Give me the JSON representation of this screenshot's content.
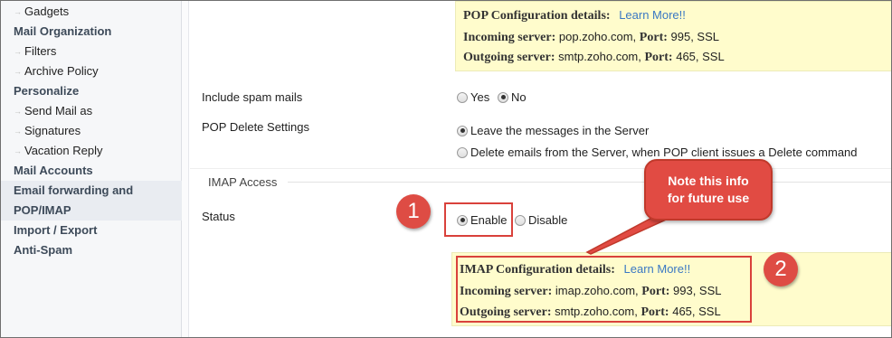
{
  "sidebar": {
    "items": [
      {
        "label": "Gadgets",
        "kind": "sub"
      },
      {
        "label": "Mail Organization",
        "kind": "heading"
      },
      {
        "label": "Filters",
        "kind": "sub"
      },
      {
        "label": "Archive Policy",
        "kind": "sub"
      },
      {
        "label": "Personalize",
        "kind": "heading"
      },
      {
        "label": "Send Mail as",
        "kind": "sub"
      },
      {
        "label": "Signatures",
        "kind": "sub"
      },
      {
        "label": "Vacation Reply",
        "kind": "sub"
      },
      {
        "label": "Mail Accounts",
        "kind": "heading"
      },
      {
        "label": "Email forwarding and",
        "kind": "heading",
        "active": true
      },
      {
        "label": "POP/IMAP",
        "kind": "heading",
        "active": true
      },
      {
        "label": "Import / Export",
        "kind": "heading"
      },
      {
        "label": "Anti-Spam",
        "kind": "heading"
      }
    ],
    "arrow_glyph": "→"
  },
  "pop_config": {
    "title": "POP Configuration details:",
    "learn_more": "Learn More!!",
    "incoming_label": "Incoming server:",
    "incoming_host": "pop.zoho.com,",
    "incoming_port_label": "Port:",
    "incoming_port": "995, SSL",
    "outgoing_label": "Outgoing server:",
    "outgoing_host": "smtp.zoho.com,",
    "outgoing_port_label": "Port:",
    "outgoing_port": "465, SSL"
  },
  "spam": {
    "label": "Include spam mails",
    "options": [
      {
        "label": "Yes",
        "selected": false
      },
      {
        "label": "No",
        "selected": true
      }
    ]
  },
  "pop_delete": {
    "label": "POP Delete Settings",
    "options": [
      {
        "label": "Leave the messages in the Server",
        "selected": true
      },
      {
        "label": "Delete emails from the Server, when POP client issues a Delete command",
        "selected": false
      }
    ]
  },
  "imap": {
    "section_title": "IMAP Access",
    "status_label": "Status",
    "options": [
      {
        "label": "Enable",
        "selected": true
      },
      {
        "label": "Disable",
        "selected": false
      }
    ]
  },
  "imap_config": {
    "title": "IMAP Configuration details:",
    "learn_more": "Learn More!!",
    "incoming_label": "Incoming server:",
    "incoming_host": "imap.zoho.com,",
    "incoming_port_label": "Port:",
    "incoming_port": "993, SSL",
    "outgoing_label": "Outgoing server:",
    "outgoing_host": "smtp.zoho.com,",
    "outgoing_port_label": "Port:",
    "outgoing_port": "465, SSL"
  },
  "annotations": {
    "badge_1": "1",
    "badge_2": "2",
    "callout_line1": "Note this info",
    "callout_line2": "for future use",
    "accent_color": "#de4c44"
  },
  "colors": {
    "info_box_bg": "#fffccc",
    "link": "#3a78c3",
    "sidebar_heading": "#3d4a59",
    "sidebar_bg": "#f6f7f9"
  }
}
